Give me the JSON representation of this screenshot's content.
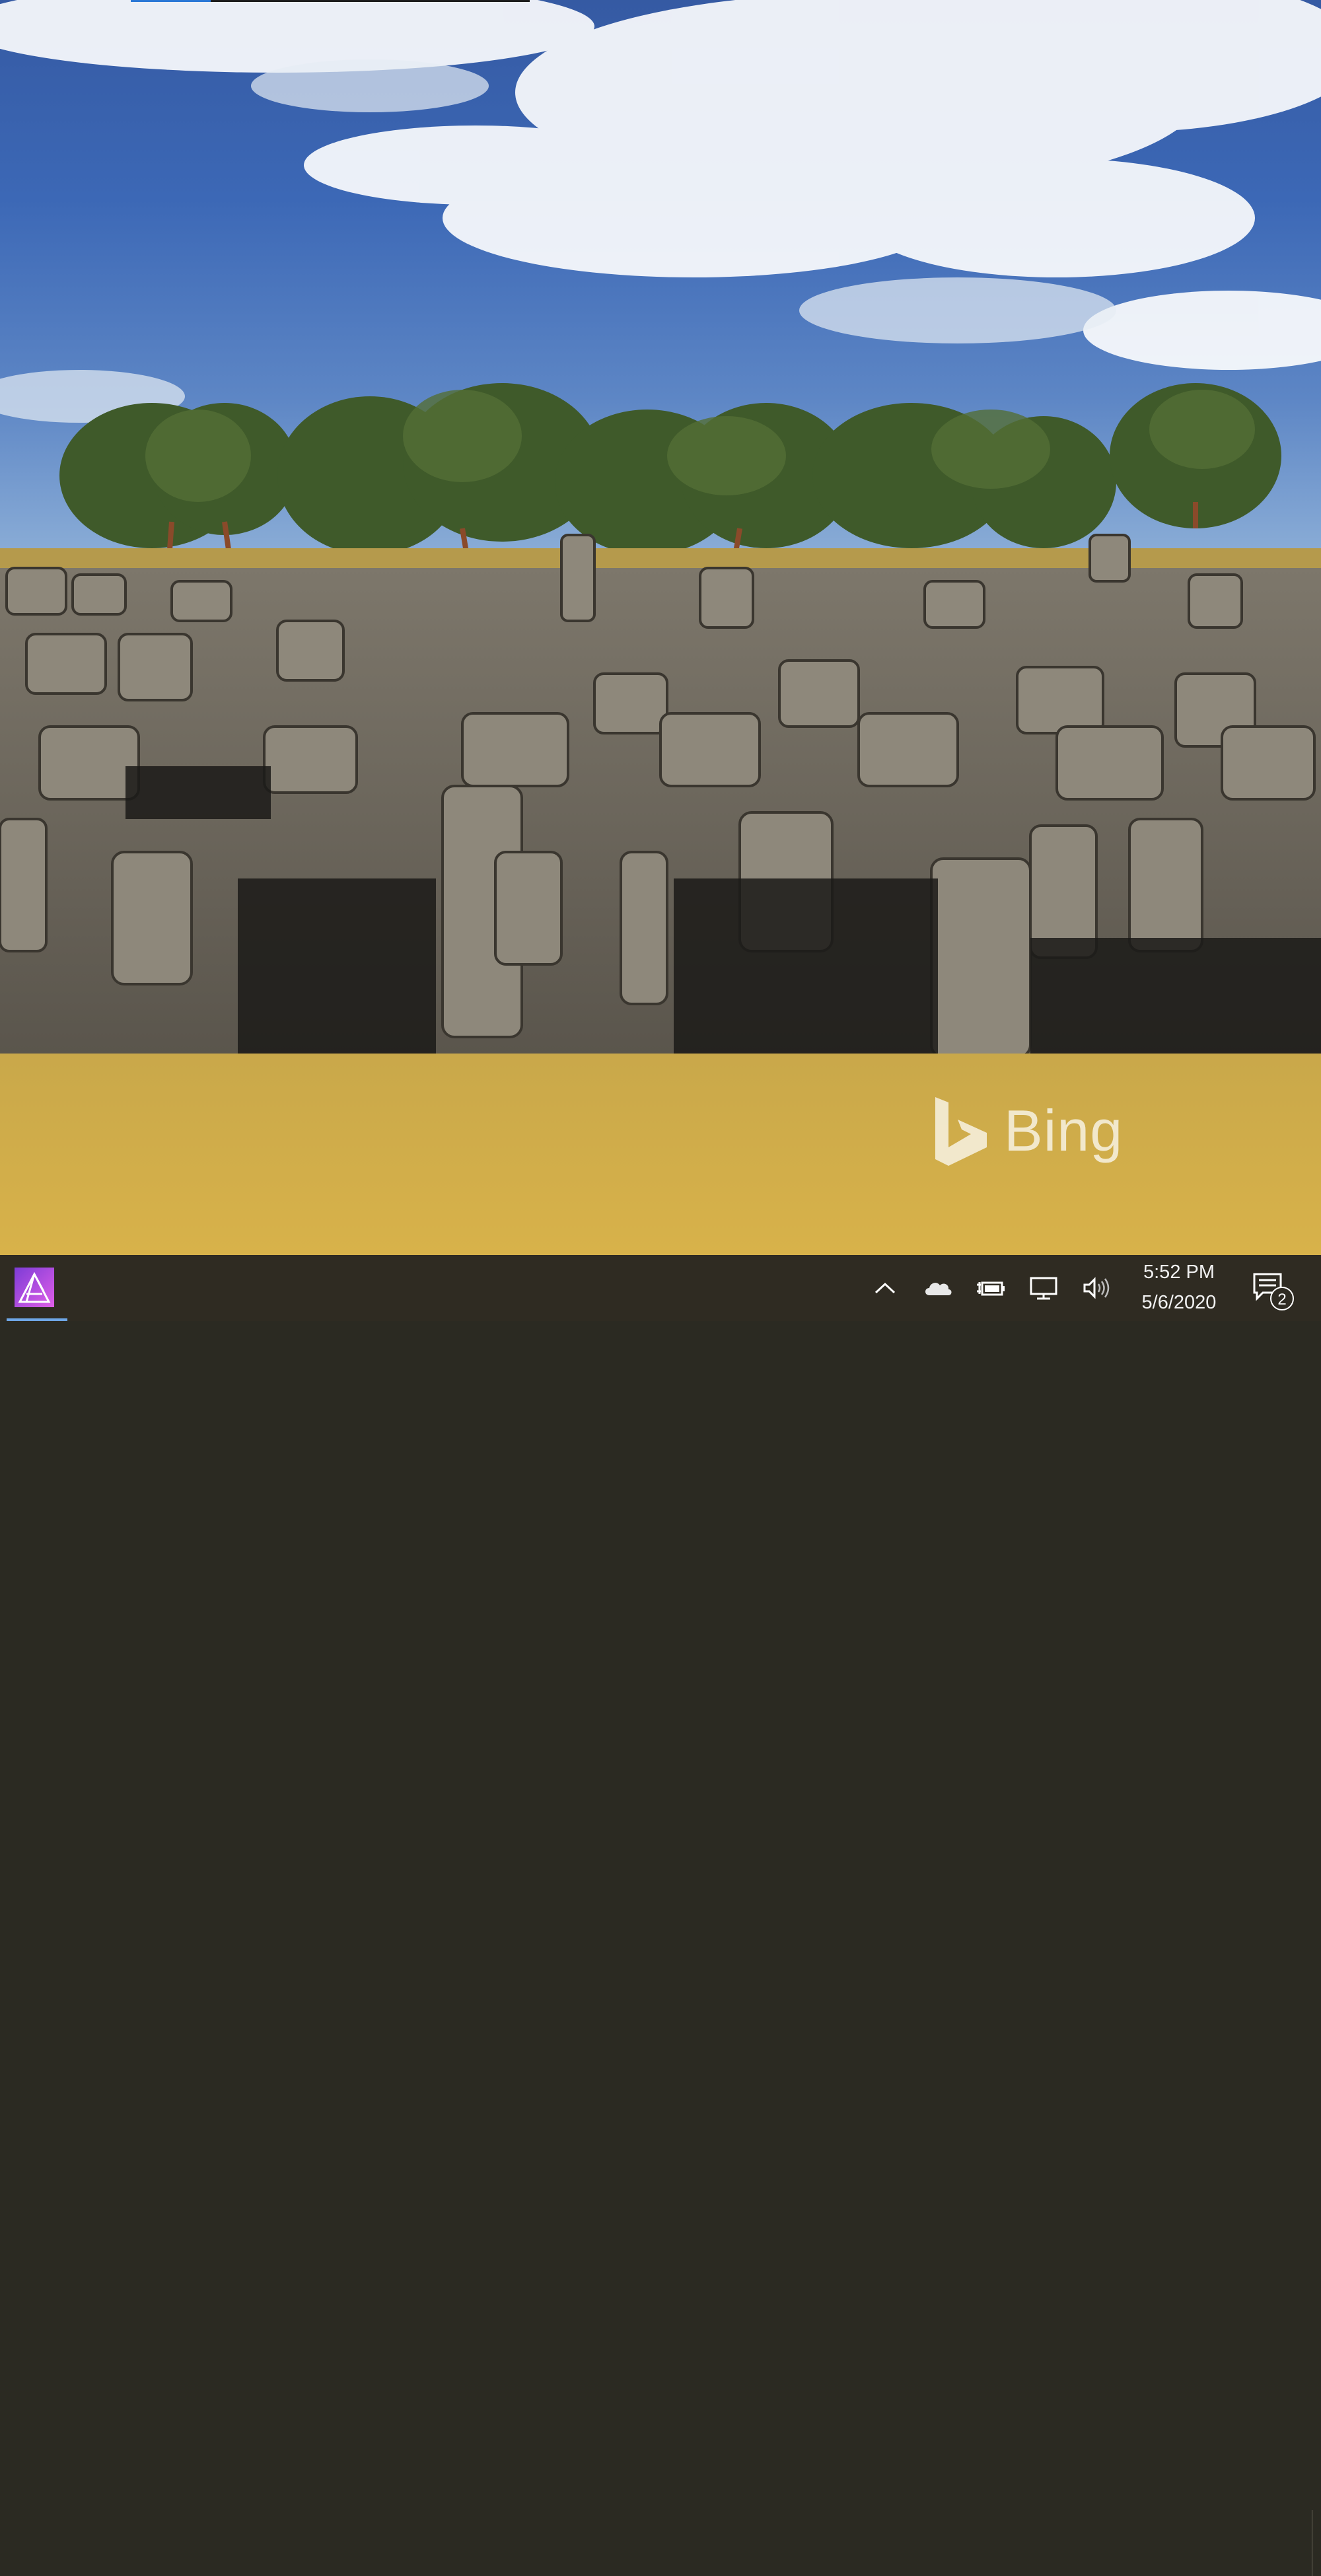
{
  "desktop": {
    "wallpaper_source": "Bing",
    "watermark_text": "Bing",
    "load_progress": 0.2
  },
  "taskbar": {
    "apps": [
      {
        "name": "Affinity Photo",
        "icon": "affinity-photo-icon",
        "active": true
      }
    ],
    "tray": {
      "chevron_icon": "chevron-up-icon",
      "onedrive_icon": "onedrive-cloud-icon",
      "power_icon": "battery-plug-icon",
      "network_icon": "network-monitor-icon",
      "volume_icon": "speaker-icon"
    },
    "clock": {
      "time": "5:52 PM",
      "date": "5/6/2020"
    },
    "action_center": {
      "icon": "notification-icon",
      "badge_count": "2"
    }
  },
  "colors": {
    "taskbar_bg": "#2f2b22",
    "accent": "#2a78d6"
  }
}
